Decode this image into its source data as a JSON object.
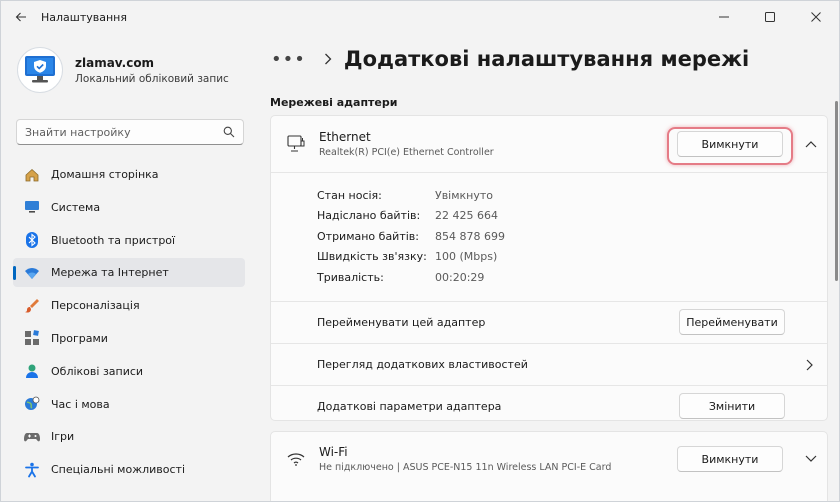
{
  "window": {
    "title": "Налаштування"
  },
  "profile": {
    "name": "zlamav.com",
    "account_type": "Локальний обліковий запис"
  },
  "search": {
    "placeholder": "Знайти настройку"
  },
  "nav": [
    {
      "label": "Домашня сторінка",
      "icon": "home-icon"
    },
    {
      "label": "Система",
      "icon": "system-icon"
    },
    {
      "label": "Bluetooth та пристрої",
      "icon": "bluetooth-icon"
    },
    {
      "label": "Мережа та Інтернет",
      "icon": "wifi-icon",
      "active": true
    },
    {
      "label": "Персоналізація",
      "icon": "brush-icon"
    },
    {
      "label": "Програми",
      "icon": "apps-icon"
    },
    {
      "label": "Облікові записи",
      "icon": "accounts-icon"
    },
    {
      "label": "Час і мова",
      "icon": "time-language-icon"
    },
    {
      "label": "Ігри",
      "icon": "gamepad-icon"
    },
    {
      "label": "Спеціальні можливості",
      "icon": "accessibility-icon"
    }
  ],
  "header": {
    "breadcrumb_dots": "•••",
    "title": "Додаткові налаштування мережі"
  },
  "section": {
    "title": "Мережеві адаптери"
  },
  "ethernet": {
    "name": "Ethernet",
    "description": "Realtek(R) PCI(e) Ethernet Controller",
    "disable_label": "Вимкнути",
    "details": [
      {
        "label": "Стан носія:",
        "value": "Увімкнуто"
      },
      {
        "label": "Надіслано байтів:",
        "value": "22 425 664"
      },
      {
        "label": "Отримано байтів:",
        "value": "854 878 699"
      },
      {
        "label": "Швидкість зв'язку:",
        "value": "100 (Mbps)"
      },
      {
        "label": "Тривалість:",
        "value": "00:20:29"
      }
    ],
    "rename_text": "Перейменувати цей адаптер",
    "rename_button": "Перейменувати",
    "view_properties_text": "Перегляд додаткових властивостей",
    "adapter_options_text": "Додаткові параметри адаптера",
    "edit_button": "Змінити"
  },
  "wifi": {
    "name": "Wi-Fi",
    "description": "Не підключено | ASUS PCE-N15 11n Wireless LAN PCI-E Card",
    "disable_label": "Вимкнути"
  },
  "colors": {
    "accent": "#0067c0",
    "highlight": "#e57b86",
    "background": "#f3f3f3",
    "card": "#fbfbfb"
  }
}
